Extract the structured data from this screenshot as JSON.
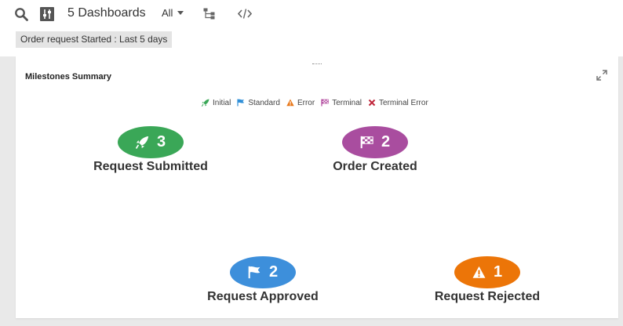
{
  "toolbar": {
    "search_icon": "search-icon",
    "filter_icon": "filter-sliders-icon",
    "dashboards_label": "5 Dashboards",
    "scope_select": "All",
    "hierarchy_icon": "hierarchy-icon",
    "code_icon": "code-icon",
    "filter_chip": "Order request Started : Last 5 days"
  },
  "panel": {
    "title": "Milestones Summary",
    "expand_icon": "expand-icon",
    "legend": [
      {
        "label": "Initial",
        "icon": "rocket-icon",
        "color": "#3aa757"
      },
      {
        "label": "Standard",
        "icon": "flag-icon",
        "color": "#2f8fd8"
      },
      {
        "label": "Error",
        "icon": "warning-icon",
        "color": "#e8781a"
      },
      {
        "label": "Terminal",
        "icon": "checkered-flag-icon",
        "color": "#b0459c"
      },
      {
        "label": "Terminal Error",
        "icon": "x-icon",
        "color": "#c0263a"
      }
    ],
    "milestones": [
      {
        "label": "Request Submitted",
        "count": "3",
        "type": "Initial",
        "color": "#3aa757",
        "icon": "rocket-icon"
      },
      {
        "label": "Order Created",
        "count": "2",
        "type": "Terminal",
        "color": "#a94d9f",
        "icon": "checkered-flag-icon"
      },
      {
        "label": "Request Approved",
        "count": "2",
        "type": "Standard",
        "color": "#3d8fdb",
        "icon": "flag-icon"
      },
      {
        "label": "Request Rejected",
        "count": "1",
        "type": "Error",
        "color": "#ec7508",
        "icon": "warning-icon"
      }
    ]
  }
}
